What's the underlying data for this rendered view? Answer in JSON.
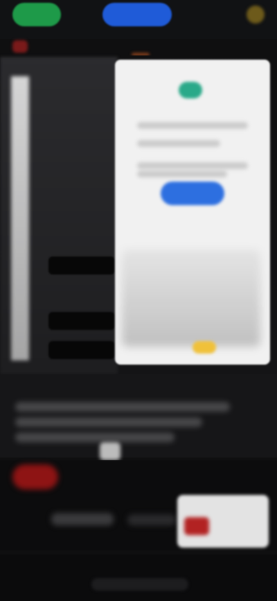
{
  "colors": {
    "background": "#0f0f10",
    "accent_green": "#1e9a49",
    "accent_blue": "#1f5bd8",
    "accent_red": "#8e1414",
    "accent_yellow": "#f0c13a"
  },
  "icons": {
    "top_right": "gear-icon",
    "more": "more-icon"
  }
}
